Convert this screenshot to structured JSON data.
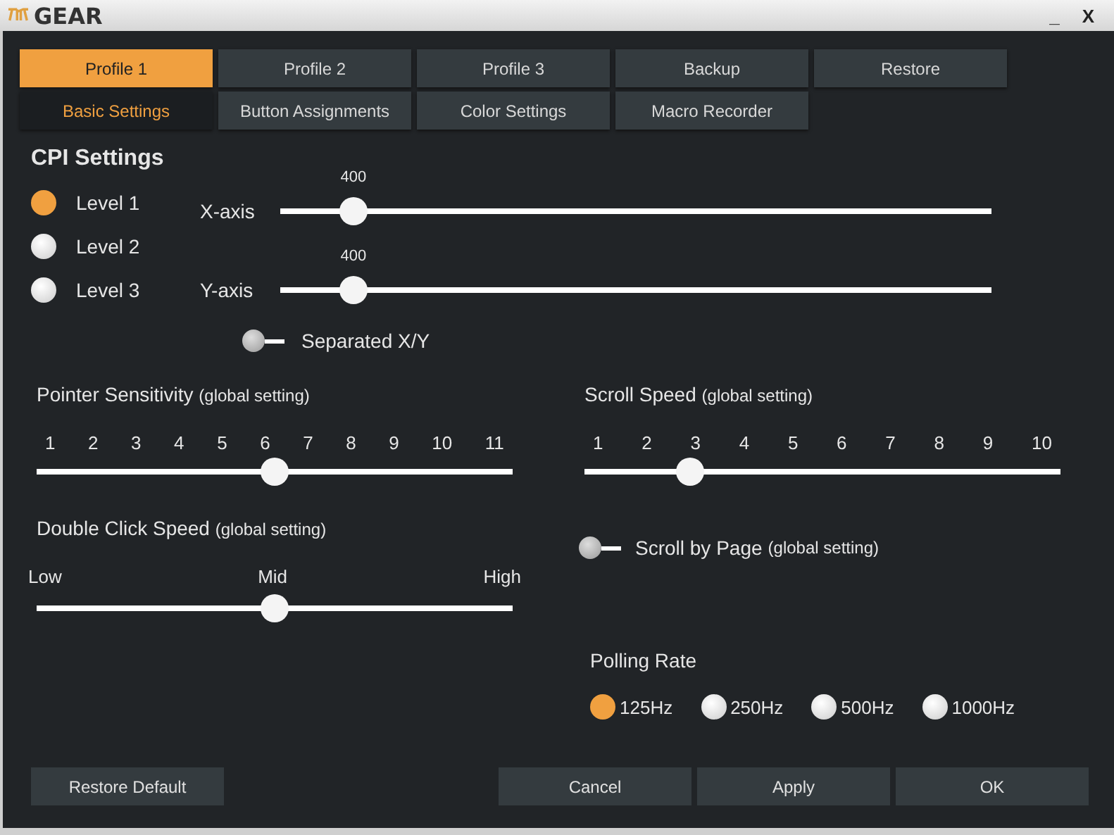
{
  "window": {
    "title": "GEAR",
    "controls": [
      "_",
      "X"
    ]
  },
  "profile_tabs": [
    {
      "label": "Profile 1",
      "selected": true
    },
    {
      "label": "Profile 2",
      "selected": false
    },
    {
      "label": "Profile 3",
      "selected": false
    },
    {
      "label": "Backup",
      "selected": false
    },
    {
      "label": "Restore",
      "selected": false
    }
  ],
  "section_tabs": [
    {
      "label": "Basic Settings",
      "selected": true
    },
    {
      "label": "Button Assignments",
      "selected": false
    },
    {
      "label": "Color Settings",
      "selected": false
    },
    {
      "label": "Macro Recorder",
      "selected": false
    }
  ],
  "cpi": {
    "title": "CPI Settings",
    "levels": [
      {
        "label": "Level 1",
        "selected": true
      },
      {
        "label": "Level 2",
        "selected": false
      },
      {
        "label": "Level 3",
        "selected": false
      }
    ],
    "axes": [
      {
        "label": "X-axis",
        "reading": "400",
        "level": 0.083
      },
      {
        "label": "Y-axis",
        "reading": "400",
        "level": 0.083
      }
    ],
    "separated": {
      "label": "Separated X/Y",
      "on": false
    }
  },
  "pointer_sensitivity": {
    "title": "Pointer Sensitivity",
    "note": "(global setting)",
    "ticks": [
      "1",
      "2",
      "3",
      "4",
      "5",
      "6",
      "7",
      "8",
      "9",
      "10",
      "11"
    ],
    "level": 0.5
  },
  "scroll_speed": {
    "title": "Scroll Speed",
    "note": "(global setting)",
    "ticks": [
      "1",
      "2",
      "3",
      "4",
      "5",
      "6",
      "7",
      "8",
      "9",
      "10"
    ],
    "level": 0.222
  },
  "double_click": {
    "title": "Double Click Speed",
    "note": "(global setting)",
    "ticks": [
      "Low",
      "Mid",
      "High"
    ],
    "level": 0.5
  },
  "scroll_by_page": {
    "label": "Scroll by Page",
    "note": "(global setting)",
    "on": false
  },
  "polling_rate": {
    "title": "Polling Rate",
    "options": [
      {
        "label": "125Hz",
        "selected": true
      },
      {
        "label": "250Hz",
        "selected": false
      },
      {
        "label": "500Hz",
        "selected": false
      },
      {
        "label": "1000Hz",
        "selected": false
      }
    ]
  },
  "footer_left": [
    "Restore Default"
  ],
  "footer_right": [
    "Cancel",
    "Apply",
    "OK"
  ]
}
